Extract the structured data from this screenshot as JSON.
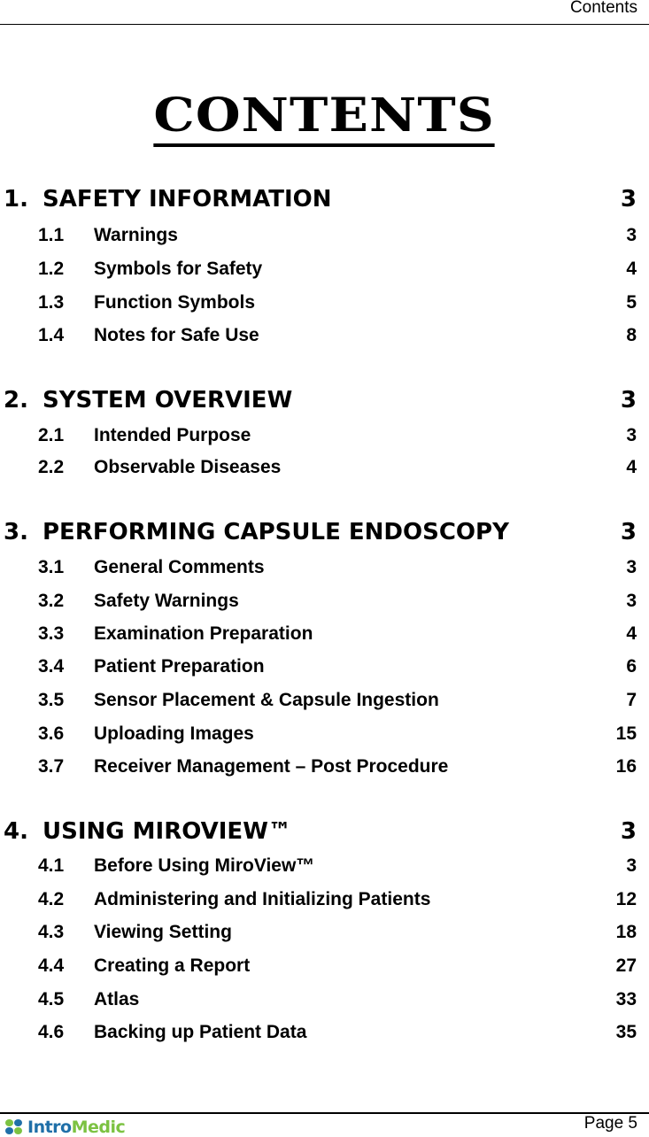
{
  "header": {
    "running_title": "Contents"
  },
  "title": "CONTENTS",
  "sections": [
    {
      "number": "1.",
      "label": "SAFETY INFORMATION",
      "page": "3",
      "items": [
        {
          "number": "1.1",
          "label": "Warnings",
          "page": "3"
        },
        {
          "number": "1.2",
          "label": "Symbols for Safety",
          "page": "4"
        },
        {
          "number": "1.3",
          "label": "Function Symbols",
          "page": "5"
        },
        {
          "number": "1.4",
          "label": "Notes for Safe Use",
          "page": "8"
        }
      ]
    },
    {
      "number": "2.",
      "label": "SYSTEM OVERVIEW",
      "page": "3",
      "items": [
        {
          "number": "2.1",
          "label": "Intended Purpose",
          "page": "3"
        },
        {
          "number": "2.2",
          "label": "Observable Diseases",
          "page": "4"
        }
      ]
    },
    {
      "number": "3.",
      "label": "PERFORMING CAPSULE ENDOSCOPY",
      "page": "3",
      "items": [
        {
          "number": "3.1",
          "label": "General Comments",
          "page": "3"
        },
        {
          "number": "3.2",
          "label": "Safety Warnings",
          "page": "3"
        },
        {
          "number": "3.3",
          "label": "Examination Preparation",
          "page": "4"
        },
        {
          "number": "3.4",
          "label": "Patient Preparation",
          "page": "6"
        },
        {
          "number": "3.5",
          "label": "Sensor Placement & Capsule Ingestion",
          "page": "7"
        },
        {
          "number": "3.6",
          "label": "Uploading Images",
          "page": "15"
        },
        {
          "number": "3.7",
          "label": "Receiver Management – Post Procedure",
          "page": "16"
        }
      ]
    },
    {
      "number": "4.",
      "label": "USING MIROVIEW™",
      "page": "3",
      "items": [
        {
          "number": "4.1",
          "label": "Before Using MiroView™",
          "page": "3"
        },
        {
          "number": "4.2",
          "label": "Administering and Initializing Patients",
          "page": "12"
        },
        {
          "number": "4.3",
          "label": "Viewing Setting",
          "page": "18"
        },
        {
          "number": "4.4",
          "label": "Creating a Report",
          "page": "27"
        },
        {
          "number": "4.5",
          "label": "Atlas",
          "page": "33"
        },
        {
          "number": "4.6",
          "label": "Backing up Patient Data",
          "page": "35"
        }
      ]
    }
  ],
  "footer": {
    "logo": {
      "part1": "Intro",
      "part2": "Medic",
      "color1": "#1f6fa8",
      "color2": "#7cc242"
    },
    "page_label": "Page 5"
  }
}
